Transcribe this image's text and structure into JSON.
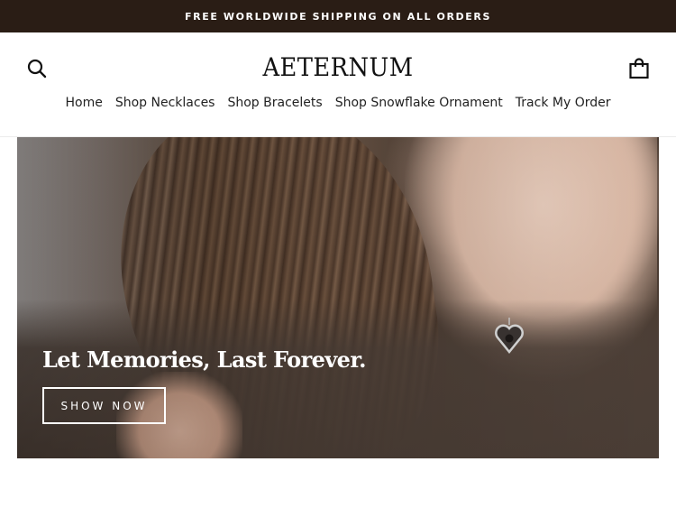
{
  "announcement": {
    "text": "FREE WORLDWIDE SHIPPING ON ALL ORDERS"
  },
  "header": {
    "logo": "AETERNUM",
    "search_icon": "search-icon",
    "cart_icon": "shopping-bag-icon"
  },
  "nav": {
    "items": [
      {
        "label": "Home"
      },
      {
        "label": "Shop Necklaces"
      },
      {
        "label": "Shop Bracelets"
      },
      {
        "label": "Shop Snowflake Ornament"
      },
      {
        "label": "Track My Order"
      }
    ]
  },
  "hero": {
    "title": "Let Memories, Last Forever.",
    "button_label": "SHOW NOW"
  },
  "colors": {
    "announcement_bg": "#2a1d15",
    "text": "#1c1c1c",
    "background": "#ffffff"
  }
}
